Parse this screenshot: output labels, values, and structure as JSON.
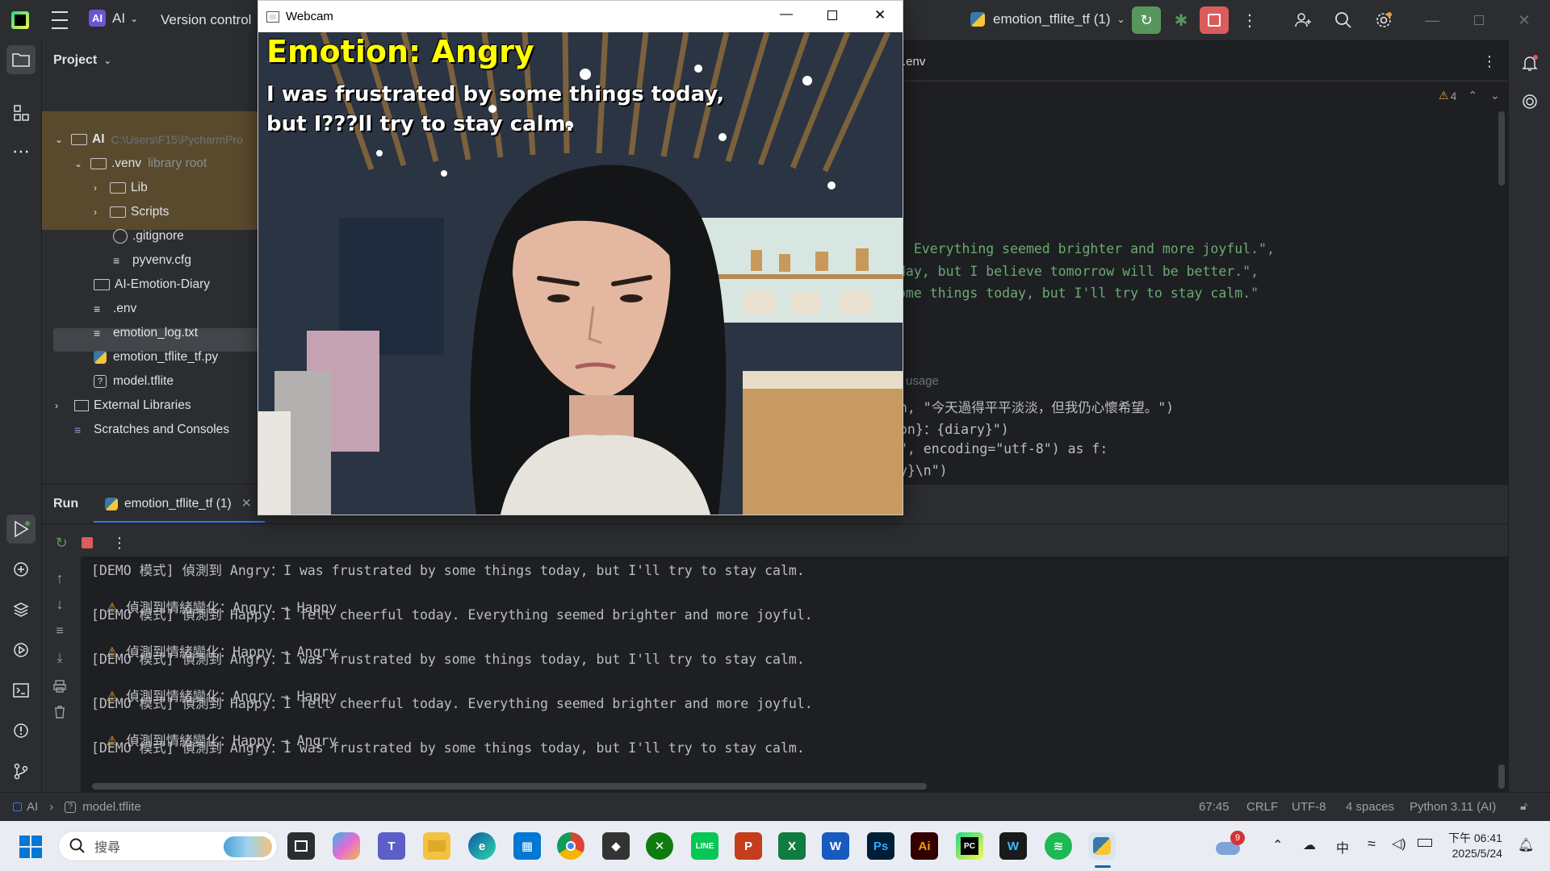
{
  "titlebar": {
    "project_badge": "AI",
    "project_name": "AI",
    "vcs": "Version control",
    "run_config": "emotion_tflite_tf (1)"
  },
  "project_panel": {
    "title": "Project",
    "items": [
      {
        "label": "AI",
        "hint": "C:\\Users\\F15\\PycharmPro"
      },
      {
        "label": ".venv",
        "hint": "library root"
      },
      {
        "label": "Lib"
      },
      {
        "label": "Scripts"
      },
      {
        "label": ".gitignore"
      },
      {
        "label": "pyvenv.cfg"
      },
      {
        "label": "AI-Emotion-Diary"
      },
      {
        "label": ".env"
      },
      {
        "label": "emotion_log.txt"
      },
      {
        "label": "emotion_tflite_tf.py"
      },
      {
        "label": "model.tflite"
      },
      {
        "label": "External Libraries"
      },
      {
        "label": "Scratches and Consoles"
      }
    ]
  },
  "editor": {
    "tab_label": ".env",
    "warnings": "4",
    "lines": [
      ". Everything seemed brighter and more joyful.\",",
      "day, but I believe tomorrow will be better.\",",
      "ome things today, but I'll try to stay calm.\"",
      "usage",
      "n, \"今天過得平平淡淡，但我仍心懷希望。\")",
      "on}：{diary}\")",
      "\", encoding=\"utf-8\") as f:",
      "y}\\n\")"
    ]
  },
  "run_panel": {
    "title": "Run",
    "tab_label": "emotion_tflite_tf (1)",
    "console": [
      {
        "type": "demo",
        "text": "[DEMO 模式] 偵測到 Angry：I was frustrated by some things today, but I'll try to stay calm."
      },
      {
        "type": "warn",
        "text": "偵測到情緒變化：Angry → Happy"
      },
      {
        "type": "demo",
        "text": "[DEMO 模式] 偵測到 Happy：I felt cheerful today. Everything seemed brighter and more joyful."
      },
      {
        "type": "warn",
        "text": "偵測到情緒變化：Happy → Angry"
      },
      {
        "type": "demo",
        "text": "[DEMO 模式] 偵測到 Angry：I was frustrated by some things today, but I'll try to stay calm."
      },
      {
        "type": "warn",
        "text": "偵測到情緒變化：Angry → Happy"
      },
      {
        "type": "demo",
        "text": "[DEMO 模式] 偵測到 Happy：I felt cheerful today. Everything seemed brighter and more joyful."
      },
      {
        "type": "warn",
        "text": "偵測到情緒變化：Happy → Angry"
      },
      {
        "type": "demo",
        "text": "[DEMO 模式] 偵測到 Angry：I was frustrated by some things today, but I'll try to stay calm."
      }
    ]
  },
  "statusbar": {
    "crumb_project": "AI",
    "crumb_file": "model.tflite",
    "position": "67:45",
    "line_sep": "CRLF",
    "encoding": "UTF-8",
    "indent": "4 spaces",
    "interpreter": "Python 3.11 (AI)"
  },
  "webcam": {
    "title": "Webcam",
    "emotion_text": "Emotion: Angry",
    "diary_line1": "I was frustrated by some things today,",
    "diary_line2": "but I???ll try to stay calm."
  },
  "taskbar": {
    "search_placeholder": "搜尋",
    "weather_badge": "9",
    "ime": "中",
    "time": "下午 06:41",
    "date": "2025/5/24"
  },
  "colors": {
    "accent_green": "#57965c",
    "accent_red": "#db5c5c",
    "string_green": "#6aab73",
    "keyword_orange": "#cf8e6d",
    "overlay_yellow": "#ffff00"
  }
}
